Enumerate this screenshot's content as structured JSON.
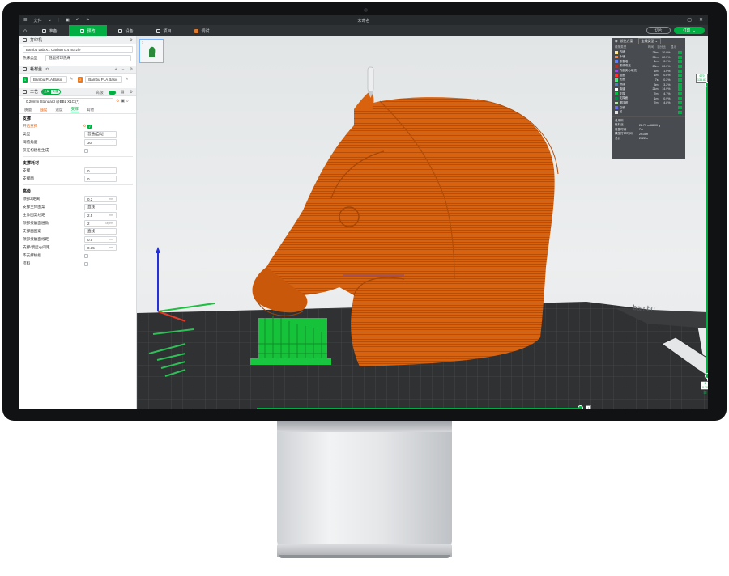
{
  "titlebar": {
    "file_menu": "文件",
    "app_title": "未命名"
  },
  "tabs": [
    {
      "label": "准备"
    },
    {
      "label": "预览"
    },
    {
      "label": "设备"
    },
    {
      "label": "项目"
    },
    {
      "label": "调试"
    }
  ],
  "actions": {
    "slice_label": "切片",
    "print_label": "打印"
  },
  "printer": {
    "section_title": "打印机",
    "printer_name": "Bambu Lab X1 Carbon 0.4 nozzle",
    "bed_type_label": "热床类型",
    "bed_type_value": "低温打印热床"
  },
  "filament": {
    "section_title": "耗材丝",
    "slot1_number": "1",
    "slot1_name": "Bambu PLA Basic",
    "slot2_number": "2",
    "slot2_name": "Bambu PLA Basic",
    "slot1_color": "#00ae42",
    "slot2_color": "#e87a1f"
  },
  "process": {
    "section_title": "工艺",
    "toggle_on": "全局",
    "toggle_off": "对象",
    "advanced_label": "高级",
    "preset": "0.20mm Standard @BBL X1C (*)",
    "subtabs": [
      "质量",
      "强度",
      "速度",
      "支撑",
      "其他"
    ]
  },
  "support": {
    "group_title": "支撑",
    "enable_label": "开启支撑",
    "type_label": "类型",
    "type_value": "普通(自动)",
    "threshold_label": "阈值角度",
    "threshold_value": "30",
    "on_build_plate_label": "仅在构建板生成"
  },
  "support_filament": {
    "group_title": "支撑耗材",
    "base_label": "支撑",
    "base_value": "0",
    "interface_label": "支撑面",
    "interface_value": "0"
  },
  "advanced": {
    "group_title": "高级",
    "rows": [
      {
        "label": "顶部Z距离",
        "value": "0.2",
        "unit": "mm"
      },
      {
        "label": "支撑主体图案",
        "value": "直线",
        "unit": ""
      },
      {
        "label": "主体图案线距",
        "value": "2.5",
        "unit": "mm"
      },
      {
        "label": "顶部接触面层数",
        "value": "2",
        "unit": "layers"
      },
      {
        "label": "支撑面图案",
        "value": "直线",
        "unit": ""
      },
      {
        "label": "顶部接触面线距",
        "value": "0.5",
        "unit": "mm"
      },
      {
        "label": "支撑/模型xy间距",
        "value": "0.35",
        "unit": "mm"
      }
    ],
    "no_bridge_label": "不支撑桥接",
    "independent_label": "挤料"
  },
  "plate": {
    "number": "1"
  },
  "legend": {
    "header_type": "颜色方案",
    "header_value": "走线类型",
    "col_type": "线条类型",
    "col_time": "时间",
    "col_pct": "百分比",
    "col_show": "显示",
    "rows": [
      {
        "name": "内墙",
        "time": "28m",
        "pct": "20.0%",
        "color": "#ffe68c"
      },
      {
        "name": "外墙",
        "time": "32m",
        "pct": "22.5%",
        "color": "#ff7d38"
      },
      {
        "name": "悬垂墙",
        "time": "1m",
        "pct": "0.9%",
        "color": "#5f7fff"
      },
      {
        "name": "稀疏填充",
        "time": "28m",
        "pct": "20.0%",
        "color": "#b03029"
      },
      {
        "name": "内部实心填充",
        "time": "1m",
        "pct": "1.0%",
        "color": "#9c4dd6"
      },
      {
        "name": "顶面",
        "time": "1m",
        "pct": "0.8%",
        "color": "#ff3030"
      },
      {
        "name": "底面",
        "time": "7s",
        "pct": "0.2%",
        "color": "#4ce57f"
      },
      {
        "name": "桥接",
        "time": "5m",
        "pct": "3.2%",
        "color": "#4d80ba"
      },
      {
        "name": "填缝",
        "time": "21m",
        "pct": "14.9%",
        "color": "#ffffff"
      },
      {
        "name": "支撑",
        "time": "7m",
        "pct": "4.7%",
        "color": "#00c040"
      },
      {
        "name": "支撑面",
        "time": "1m",
        "pct": "0.9%",
        "color": "#008844"
      },
      {
        "name": "擦拭塔",
        "time": "7m",
        "pct": "4.8%",
        "color": "#b3e3ab"
      },
      {
        "name": "空驶",
        "time": "",
        "pct": "",
        "color": "#6a6fe0"
      },
      {
        "name": "回",
        "time": "",
        "pct": "",
        "color": "#e0e0e0"
      }
    ],
    "summary_title": "总用料",
    "summary": [
      {
        "key": "耗材丝",
        "value": "22.77 m  68.00 g"
      },
      {
        "key": "准备时间",
        "value": "7m"
      },
      {
        "key": "模型打印时间",
        "value": "2h15m"
      },
      {
        "key": "总计",
        "value": "2h22m"
      }
    ]
  },
  "layer_slider": {
    "top_label": "679",
    "top_height": "135.83",
    "bottom_label": "1",
    "bottom_height": "0.20"
  },
  "colors": {
    "accent": "#00ae42",
    "model": "#d8620e",
    "support": "#16c23a"
  }
}
